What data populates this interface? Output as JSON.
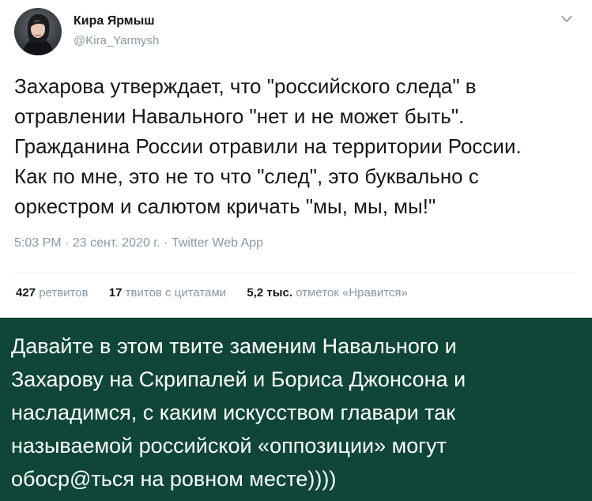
{
  "tweet": {
    "author": {
      "name": "Кира Ярмыш",
      "handle": "@Kira_Yarmysh",
      "avatar_icon": "user-avatar-photo"
    },
    "menu_icon": "chevron-down-icon",
    "text_lines": [
      "Захарова утверждает, что \"российского следа\" в",
      "отравлении Навального \"нет и не может быть\".",
      "Гражданина России отравили на территории России.",
      "Как по мне, это не то что \"след\", это буквально с",
      "оркестром и салютом кричать \"мы, мы, мы!\""
    ],
    "time": "5:03 PM",
    "date": "23 сент. 2020 г.",
    "source": "Twitter Web App",
    "separator": "·",
    "stats": {
      "retweets": {
        "count": "427",
        "label": "ретвитов"
      },
      "quotes": {
        "count": "17",
        "label": "твитов с цитатами"
      },
      "likes": {
        "count": "5,2 тыс.",
        "label": "отметок «Нравится»"
      }
    }
  },
  "caption": {
    "lines": [
      "Давайте в этом твите заменим Навального и",
      "Захарову на Скрипалей и Бориса Джонсона и",
      "насладимся, с каким искусством главари так",
      "называемой российской «оппозиции» могут",
      "обоср@ться на ровном месте))))"
    ],
    "background_color": "#0f4637",
    "text_color": "#ffffff"
  },
  "colors": {
    "text_primary": "#14171a",
    "text_secondary": "#8899a6",
    "divider": "#e6ecf0"
  }
}
